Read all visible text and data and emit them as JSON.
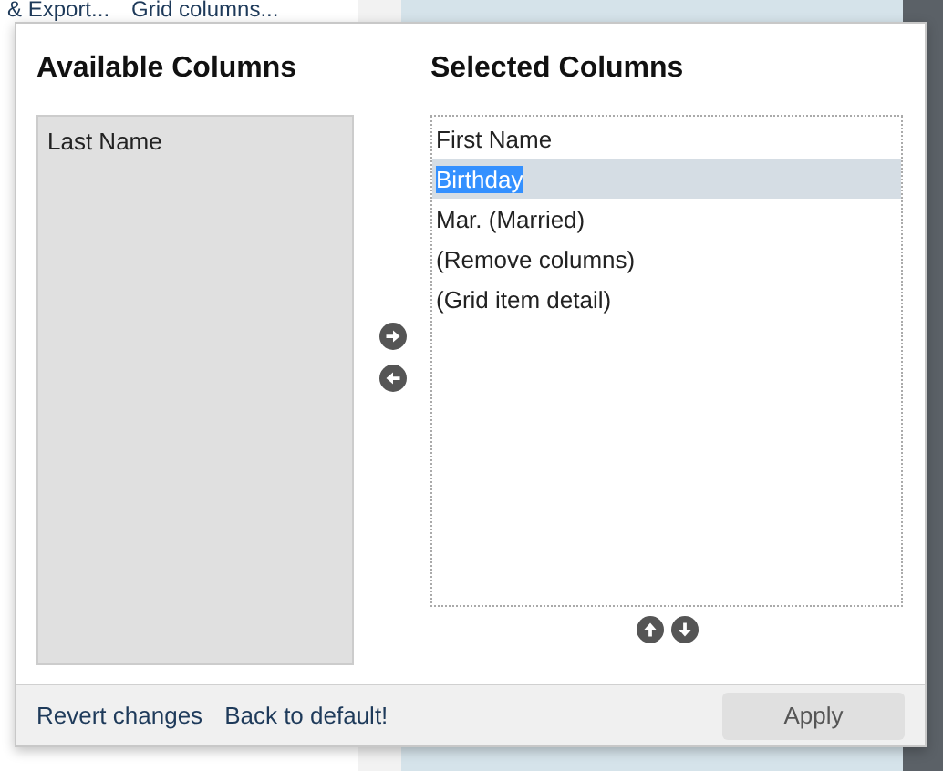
{
  "background": {
    "toolbar_items": [
      "& Export...",
      "Grid columns..."
    ]
  },
  "dialog": {
    "available": {
      "title": "Available Columns",
      "items": [
        {
          "label": "Last Name",
          "selected": false
        }
      ]
    },
    "selected": {
      "title": "Selected Columns",
      "items": [
        {
          "label": "First Name",
          "selected": false
        },
        {
          "label": "Birthday",
          "selected": true
        },
        {
          "label": "Mar. (Married)",
          "selected": false
        },
        {
          "label": "(Remove columns)",
          "selected": false
        },
        {
          "label": "(Grid item detail)",
          "selected": false
        }
      ]
    },
    "links": [
      "Revert changes",
      "Back to default!"
    ],
    "apply": "Apply"
  }
}
